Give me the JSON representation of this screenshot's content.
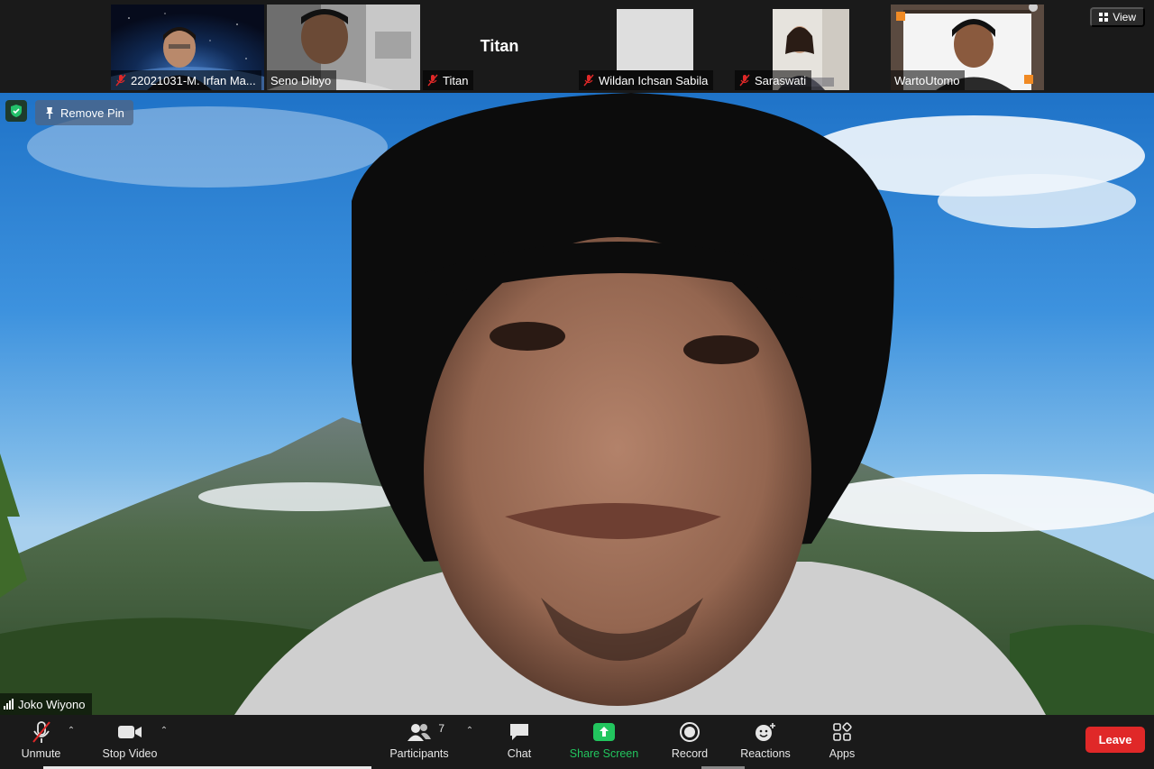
{
  "gallery": {
    "tiles": [
      {
        "name": "22021031-M. Irfan Ma...",
        "muted": true
      },
      {
        "name": "Seno Dibyo",
        "muted": false
      },
      {
        "name": "Titan",
        "muted": true,
        "video_off_label": "Titan"
      },
      {
        "name": "Wildan Ichsan Sabila",
        "muted": true
      },
      {
        "name": "Saraswati",
        "muted": true
      },
      {
        "name": "WartoUtomo",
        "muted": false
      }
    ],
    "view_label": "View"
  },
  "main": {
    "remove_pin_label": "Remove Pin",
    "speaker_name": "Joko Wiyono"
  },
  "toolbar": {
    "unmute_label": "Unmute",
    "stop_video_label": "Stop Video",
    "participants_label": "Participants",
    "participants_count": "7",
    "chat_label": "Chat",
    "share_screen_label": "Share Screen",
    "record_label": "Record",
    "reactions_label": "Reactions",
    "apps_label": "Apps",
    "leave_label": "Leave"
  },
  "colors": {
    "toolbar_bg": "#1a1a1a",
    "share_green": "#22c55e",
    "leave_red": "#e02828",
    "active_speaker_outline": "#2d8cff"
  }
}
